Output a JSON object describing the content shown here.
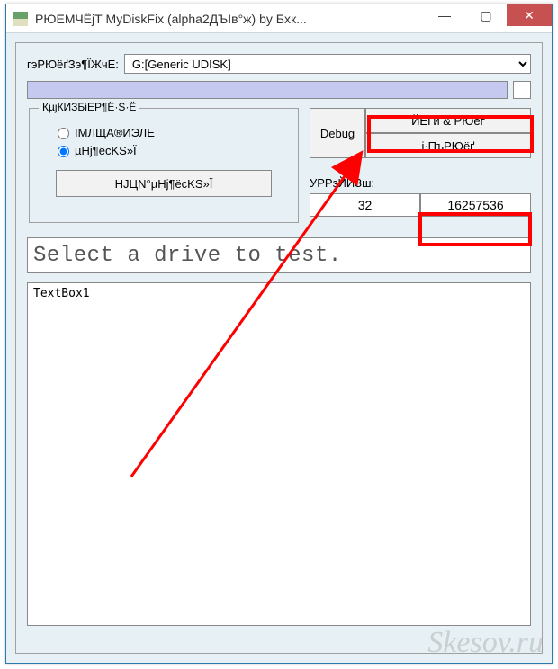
{
  "window": {
    "title": "РЮЕМЧЁјТ MyDiskFix (alpha2ДЪІв°ж) by Бхк..."
  },
  "drive": {
    "label": "гэРЮёґЗэ¶ЇЖчЕ:",
    "selected": "G:[Generic UDISK]"
  },
  "group": {
    "legend": "КµјКИЗБіЕР¶Ё·S·Ё",
    "radio1_label": "ІМЛЩА®ИЭЛЕ",
    "radio2_label": "µНј¶ёcKS»Ї",
    "button_label": "НЈЦN°µНј¶ёcKS»Ї"
  },
  "actions": {
    "debug_label": "Debug",
    "btn1_label": "ЙЁГи & РЮёґ",
    "btn2_label": "і·ПъРЮёґ"
  },
  "stats": {
    "label": "УРРзЙИЗш:",
    "value_left": "32",
    "value_right": "16257536"
  },
  "status": {
    "text": "Select a drive to test."
  },
  "log": {
    "text": "TextBox1"
  },
  "watermark": "Skesov.ru"
}
